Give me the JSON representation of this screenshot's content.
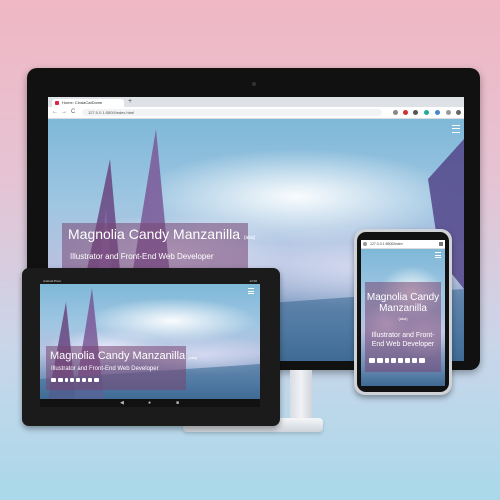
{
  "browser": {
    "tab_title": "Home: CindaCatDome",
    "new_tab": "+",
    "url": "127.0.0.1:5500/index.html",
    "nav": [
      "←",
      "→",
      "C"
    ]
  },
  "hero": {
    "name": "Magnolia Candy Manzanilla",
    "aka": "(aka)",
    "role": "Illustrator and Front-End Web Developer"
  },
  "tablet": {
    "status_left": "Android Pixel",
    "status_right": "12:00",
    "nav": [
      "◀",
      "●",
      "■"
    ]
  },
  "phone": {
    "url": "127.0.0.1:5500/index"
  },
  "colors": {
    "overlay": "#784673",
    "background_top": "#f0b7c4",
    "background_bottom": "#a9d9ea"
  },
  "social_icons": [
    "youtube-icon",
    "twitter-icon",
    "tumblr-icon",
    "instagram-icon",
    "facebook-icon",
    "deviantart-icon",
    "pinterest-icon",
    "email-icon"
  ]
}
